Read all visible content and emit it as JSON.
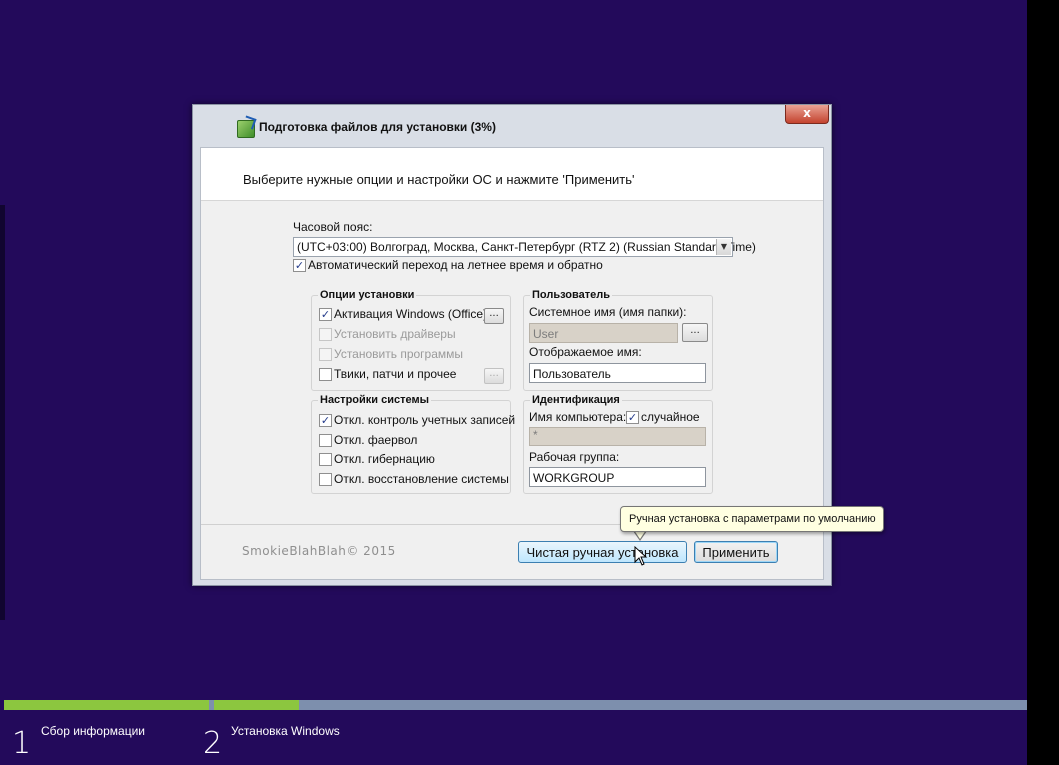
{
  "dialog": {
    "title": "Подготовка файлов для установки (3%)",
    "close_label": "x",
    "instruction": "Выберите нужные опции и настройки ОС и нажмите 'Применить'",
    "timezone": {
      "label": "Часовой пояс:",
      "value": "(UTC+03:00) Волгоград, Москва, Санкт-Петербург (RTZ 2) (Russian Standard Time)",
      "dst_label": "Автоматический переход на летнее время и обратно",
      "dst_checked": true
    },
    "install_options": {
      "title": "Опции установки",
      "items": [
        {
          "label": "Активация Windows (Office)",
          "checked": true,
          "enabled": true
        },
        {
          "label": "Установить драйверы",
          "checked": false,
          "enabled": false
        },
        {
          "label": "Установить программы",
          "checked": false,
          "enabled": false
        },
        {
          "label": "Твики, патчи и прочее",
          "checked": false,
          "enabled": true
        }
      ],
      "browse_label": "..."
    },
    "system_settings": {
      "title": "Настройки системы",
      "items": [
        {
          "label": "Откл. контроль учетных записей",
          "checked": true
        },
        {
          "label": "Откл. фаервол",
          "checked": false
        },
        {
          "label": "Откл. гибернацию",
          "checked": false
        },
        {
          "label": "Откл. восстановление системы",
          "checked": false
        }
      ]
    },
    "user": {
      "title": "Пользователь",
      "system_name_label": "Системное имя (имя папки):",
      "system_name_value": "User",
      "browse_label": "...",
      "display_name_label": "Отображаемое имя:",
      "display_name_value": "Пользователь"
    },
    "identification": {
      "title": "Идентификация",
      "computer_name_label": "Имя компьютера:",
      "random_label": "случайное",
      "random_checked": true,
      "computer_name_value": "*",
      "workgroup_label": "Рабочая группа:",
      "workgroup_value": "WORKGROUP"
    },
    "copyright": "SmokieBlahBlah© 2015",
    "buttons": {
      "manual": "Чистая ручная установка",
      "apply": "Применить"
    },
    "tooltip": "Ручная установка с параметрами по умолчанию"
  },
  "setup_steps": [
    {
      "number": "1",
      "label": "Сбор информации"
    },
    {
      "number": "2",
      "label": "Установка Windows"
    }
  ],
  "colors": {
    "background": "#230a5b",
    "progress_done": "#8cc63f",
    "progress_track": "#7d8fad"
  }
}
